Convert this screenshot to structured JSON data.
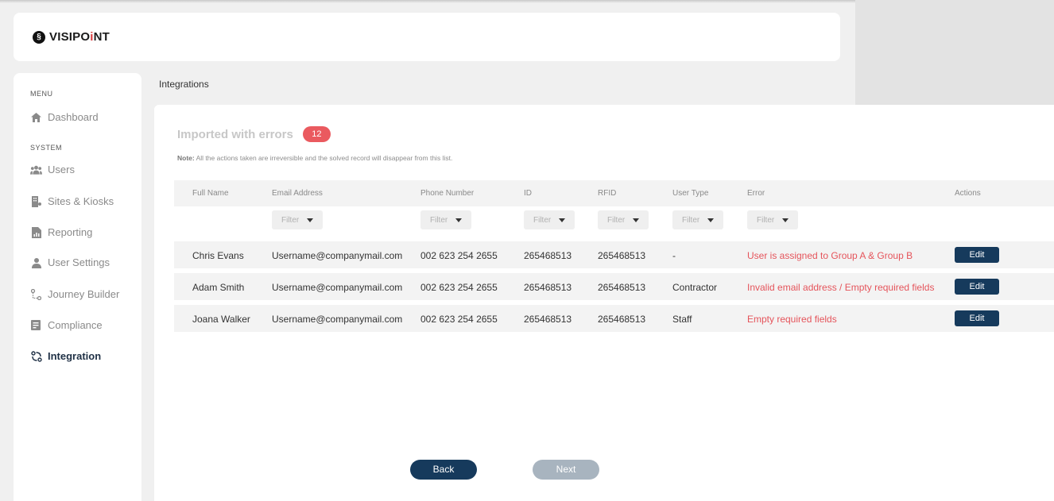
{
  "brand": {
    "logo_mark": "§",
    "name_part1": "VISIPO",
    "name_accent": "i",
    "name_part2": "NT"
  },
  "sidebar": {
    "menu_label": "MENU",
    "system_label": "SYSTEM",
    "items": [
      {
        "label": "Dashboard",
        "icon": "home-icon"
      },
      {
        "label": "Users",
        "icon": "users-icon"
      },
      {
        "label": "Sites & Kiosks",
        "icon": "building-icon"
      },
      {
        "label": "Reporting",
        "icon": "report-icon"
      },
      {
        "label": "User Settings",
        "icon": "user-icon"
      },
      {
        "label": "Journey Builder",
        "icon": "journey-icon"
      },
      {
        "label": "Compliance",
        "icon": "compliance-icon"
      },
      {
        "label": "Integration",
        "icon": "integration-icon",
        "active": true
      }
    ]
  },
  "breadcrumb": "Integrations",
  "main": {
    "title": "Imported with errors",
    "error_count": "12",
    "note_prefix": "Note:",
    "note_text": " All the actions taken are irreversible and the solved record will disappear from this list."
  },
  "table": {
    "columns": [
      "Full Name",
      "Email Address",
      "Phone Number",
      "ID",
      "RFID",
      "User Type",
      "Error",
      "Actions"
    ],
    "filter_label": "Filter",
    "rows": [
      {
        "name": "Chris Evans",
        "email": "Username@companymail.com",
        "phone": "002 623 254 2655",
        "id": "265468513",
        "rfid": "265468513",
        "type": "-",
        "error": "User is assigned to Group A & Group B",
        "action": "Edit"
      },
      {
        "name": "Adam Smith",
        "email": "Username@companymail.com",
        "phone": "002 623 254 2655",
        "id": "265468513",
        "rfid": "265468513",
        "type": "Contractor",
        "error": "Invalid email address / Empty required fields",
        "action": "Edit"
      },
      {
        "name": "Joana Walker",
        "email": "Username@companymail.com",
        "phone": "002 623 254 2655",
        "id": "265468513",
        "rfid": "265468513",
        "type": "Staff",
        "error": "Empty required fields",
        "action": "Edit"
      }
    ]
  },
  "footer": {
    "back_label": "Back",
    "next_label": "Next"
  },
  "colors": {
    "primary": "#163a5c",
    "error": "#e5545b",
    "badge": "#ea5a5f",
    "disabled": "#a8b4bf"
  }
}
